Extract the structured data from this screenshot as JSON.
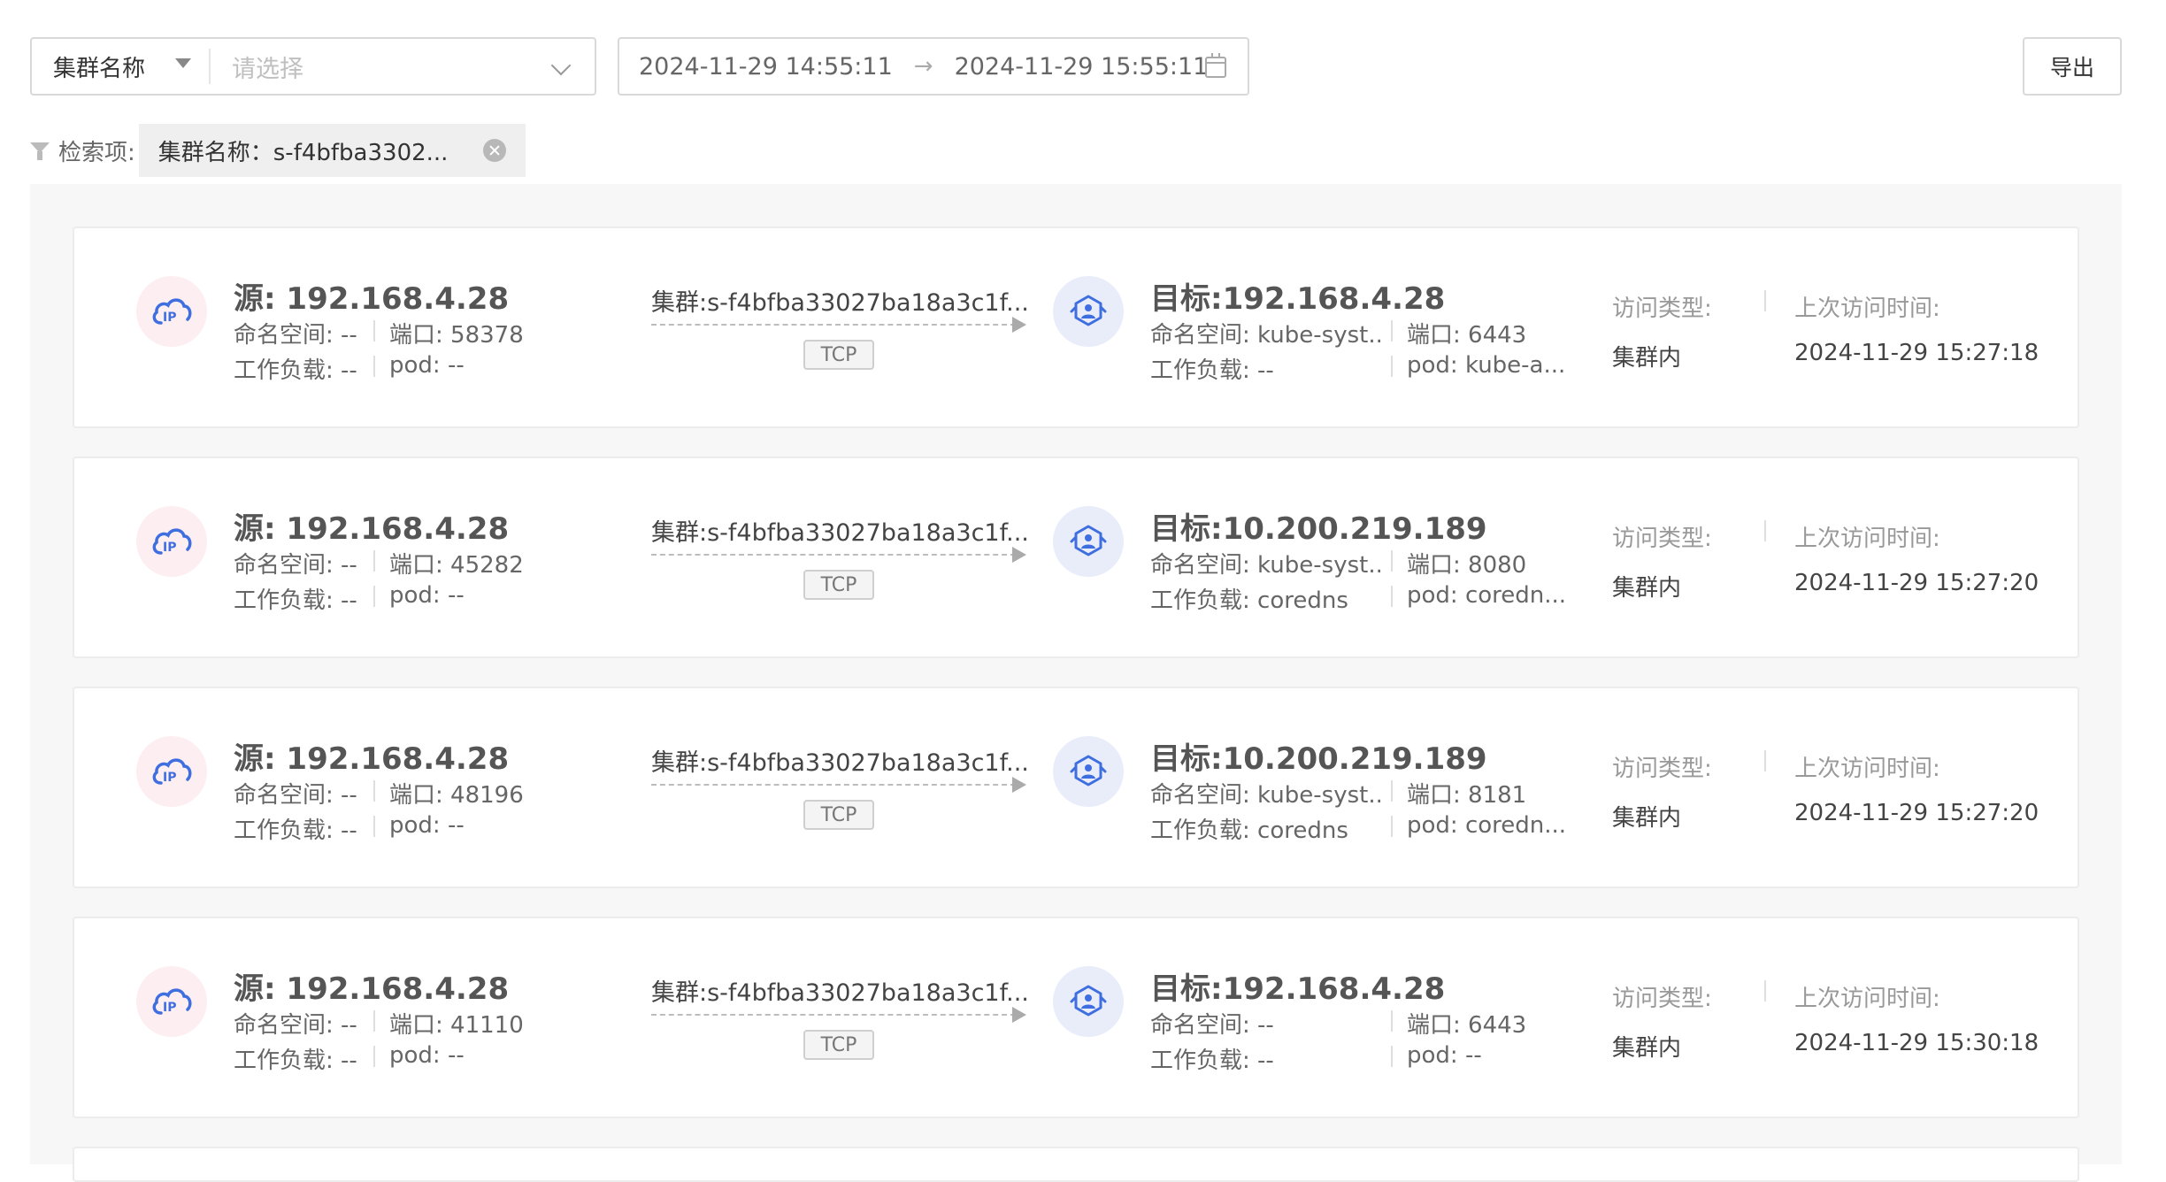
{
  "toolbar": {
    "cluster_field_label": "集群名称",
    "cluster_placeholder": "请选择",
    "start_time": "2024-11-29 14:55:11",
    "range_arrow": "→",
    "end_time": "2024-11-29 15:55:11",
    "export_label": "导出"
  },
  "filter": {
    "label": "检索项:",
    "tag_text": "集群名称：s-f4bfba3302..."
  },
  "labels": {
    "namespace": "命名空间: ",
    "workload": "工作负载: ",
    "port": "端口: ",
    "pod": "pod: ",
    "access_type": "访问类型:",
    "last_access": "上次访问时间:"
  },
  "cards": [
    {
      "source": "源: 192.168.4.28",
      "src_namespace": "命名空间: --",
      "src_workload": "工作负载: --",
      "src_port": "端口: 58378",
      "src_pod": "pod: --",
      "cluster": "集群:s-f4bfba33027ba18a3c1f...",
      "protocol": "TCP",
      "target": "目标:192.168.4.28",
      "dst_namespace": "命名空间: kube-syst...",
      "dst_workload": "工作负载: --",
      "dst_port": "端口: 6443",
      "dst_pod": "pod: kube-a...",
      "access_type": "集群内",
      "last_access": "2024-11-29 15:27:18"
    },
    {
      "source": "源: 192.168.4.28",
      "src_namespace": "命名空间: --",
      "src_workload": "工作负载: --",
      "src_port": "端口: 45282",
      "src_pod": "pod: --",
      "cluster": "集群:s-f4bfba33027ba18a3c1f...",
      "protocol": "TCP",
      "target": "目标:10.200.219.189",
      "dst_namespace": "命名空间: kube-syst...",
      "dst_workload": "工作负载: coredns",
      "dst_port": "端口: 8080",
      "dst_pod": "pod: coredn...",
      "access_type": "集群内",
      "last_access": "2024-11-29 15:27:20"
    },
    {
      "source": "源: 192.168.4.28",
      "src_namespace": "命名空间: --",
      "src_workload": "工作负载: --",
      "src_port": "端口: 48196",
      "src_pod": "pod: --",
      "cluster": "集群:s-f4bfba33027ba18a3c1f...",
      "protocol": "TCP",
      "target": "目标:10.200.219.189",
      "dst_namespace": "命名空间: kube-syst...",
      "dst_workload": "工作负载: coredns",
      "dst_port": "端口: 8181",
      "dst_pod": "pod: coredn...",
      "access_type": "集群内",
      "last_access": "2024-11-29 15:27:20"
    },
    {
      "source": "源: 192.168.4.28",
      "src_namespace": "命名空间: --",
      "src_workload": "工作负载: --",
      "src_port": "端口: 41110",
      "src_pod": "pod: --",
      "cluster": "集群:s-f4bfba33027ba18a3c1f...",
      "protocol": "TCP",
      "target": "目标:192.168.4.28",
      "dst_namespace": "命名空间: --",
      "dst_workload": "工作负载: --",
      "dst_port": "端口: 6443",
      "dst_pod": "pod: --",
      "access_type": "集群内",
      "last_access": "2024-11-29 15:30:18"
    }
  ]
}
